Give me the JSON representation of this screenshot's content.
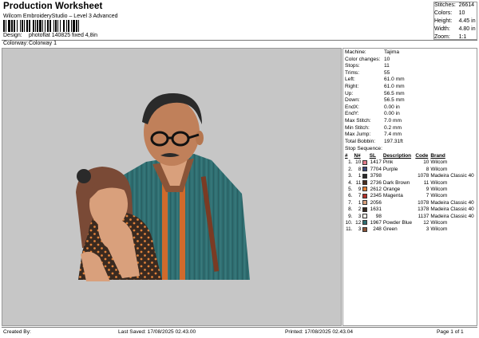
{
  "header": {
    "title": "Production Worksheet",
    "subtitle": "Wilcom EmbroideryStudio – Level 3 Advanced",
    "barcode_text": ""
  },
  "stats": {
    "stitches_label": "Stitches:",
    "stitches": "26614",
    "colors_label": "Colors:",
    "colors": "10",
    "height_label": "Height:",
    "height": "4.45 in",
    "width_label": "Width:",
    "width": "4.80 in",
    "zoom_label": "Zoom:",
    "zoom": "1:1"
  },
  "info": {
    "design_label": "Design:",
    "design": "photoflat 140825 fixed 4,8in",
    "colorway_label": "Colorway:",
    "colorway": "Colorway 1"
  },
  "params": [
    {
      "k": "Machine:",
      "v": "Tajima"
    },
    {
      "k": "Color changes:",
      "v": "10"
    },
    {
      "k": "Stops:",
      "v": "11"
    },
    {
      "k": "Trims:",
      "v": "55"
    },
    {
      "k": "Left:",
      "v": "61.0 mm"
    },
    {
      "k": "Right:",
      "v": "61.0 mm"
    },
    {
      "k": "Up:",
      "v": "56.5 mm"
    },
    {
      "k": "Down:",
      "v": "56.5 mm"
    },
    {
      "k": "EndX:",
      "v": "0.00 in"
    },
    {
      "k": "EndY:",
      "v": "0.00 in"
    },
    {
      "k": "Max Stitch:",
      "v": "7.0 mm"
    },
    {
      "k": "Min Stitch:",
      "v": "0.2 mm"
    },
    {
      "k": "Max Jump:",
      "v": "7.4 mm"
    },
    {
      "k": "Total Bobbin:",
      "v": "197.31ft"
    }
  ],
  "sequence": {
    "title": "Stop Sequence:",
    "columns": {
      "num": "#",
      "n": "N#",
      "sl": "SL",
      "desc": "Description",
      "code": "Code",
      "brand": "Brand"
    },
    "rows": [
      {
        "num": "1.",
        "n": "10",
        "color": "#e07a8a",
        "sl": "1417",
        "desc": "Pink",
        "code": "10",
        "brand": "Wilcom"
      },
      {
        "num": "2.",
        "n": "8",
        "color": "#3d4a7a",
        "sl": "7704",
        "desc": "Purple",
        "code": "8",
        "brand": "Wilcom"
      },
      {
        "num": "3.",
        "n": "1",
        "color": "#2a2a2a",
        "sl": "3798",
        "desc": "",
        "code": "1078",
        "brand": "Madeira Classic 40"
      },
      {
        "num": "4.",
        "n": "11",
        "color": "#4a2f22",
        "sl": "2736",
        "desc": "Dark Brown",
        "code": "11",
        "brand": "Wilcom"
      },
      {
        "num": "5.",
        "n": "9",
        "color": "#e0813a",
        "sl": "2612",
        "desc": "Orange",
        "code": "9",
        "brand": "Wilcom"
      },
      {
        "num": "6.",
        "n": "7",
        "color": "#b4302a",
        "sl": "2345",
        "desc": "Magenta",
        "code": "7",
        "brand": "Wilcom"
      },
      {
        "num": "7.",
        "n": "1",
        "color": "#d9a07c",
        "sl": "2056",
        "desc": "",
        "code": "1078",
        "brand": "Madeira Classic 40"
      },
      {
        "num": "8.",
        "n": "2",
        "color": "#3a2a20",
        "sl": "1631",
        "desc": "",
        "code": "1378",
        "brand": "Madeira Classic 40"
      },
      {
        "num": "9.",
        "n": "3",
        "color": "#f2efe8",
        "sl": "98",
        "desc": "",
        "code": "1137",
        "brand": "Madeira Classic 40"
      },
      {
        "num": "10.",
        "n": "12",
        "color": "#2f6f72",
        "sl": "1967",
        "desc": "Powder Blue",
        "code": "12",
        "brand": "Wilcom"
      },
      {
        "num": "11.",
        "n": "3",
        "color": "#8a5438",
        "sl": "248",
        "desc": "Green",
        "code": "3",
        "brand": "Wilcom"
      }
    ]
  },
  "footer": {
    "created": "Created By:",
    "saved": "Last Saved: 17/08/2025 02.43.00",
    "printed": "Printed: 17/08/2025 02.43.04",
    "page": "Page 1 of 1"
  },
  "colors": {
    "canvas_bg": "#c6c6c6",
    "shirt_teal": "#2f6f72",
    "shirt_stripe": "#d06a2c",
    "skin": "#d9a07c",
    "hair": "#2a2a2a"
  }
}
